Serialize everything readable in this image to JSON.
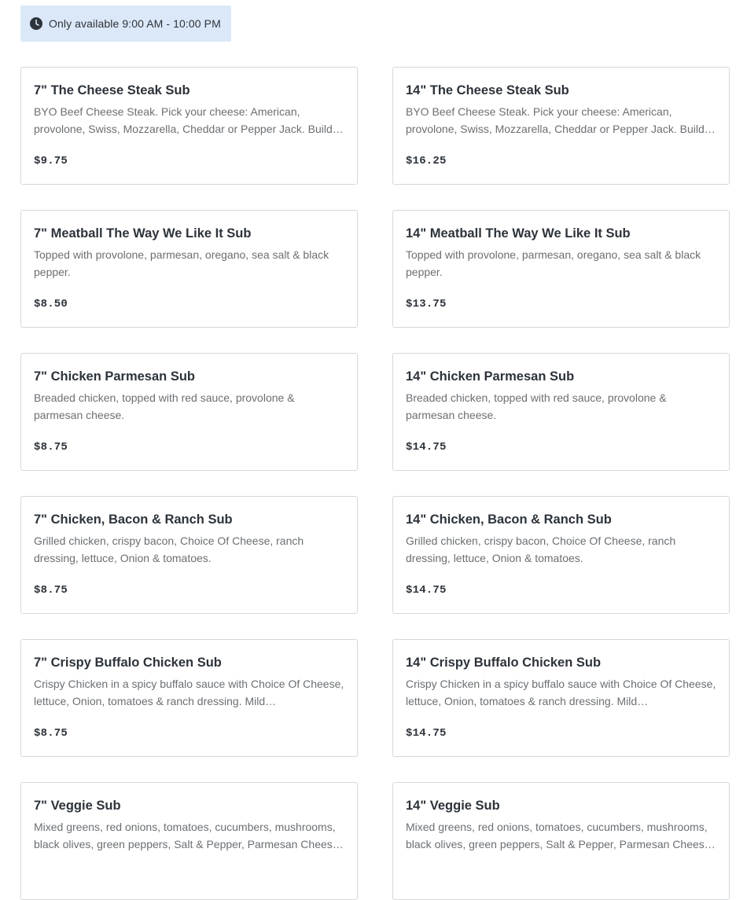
{
  "availability": {
    "icon": "clock-icon",
    "text": "Only available 9:00 AM - 10:00 PM"
  },
  "menu_items": [
    {
      "title": "7\" The Cheese Steak Sub",
      "description": "BYO Beef Cheese Steak. Pick your cheese: American, provolone, Swiss, Mozzarella, Cheddar or Pepper Jack. Build …",
      "price": "$9.75"
    },
    {
      "title": "14\" The Cheese Steak Sub",
      "description": "BYO Beef Cheese Steak. Pick your cheese: American, provolone, Swiss, Mozzarella, Cheddar or Pepper Jack. Build …",
      "price": "$16.25"
    },
    {
      "title": "7\" Meatball The Way We Like It Sub",
      "description": "Topped with provolone, parmesan, oregano, sea salt & black pepper.",
      "price": "$8.50"
    },
    {
      "title": "14\" Meatball The Way We Like It Sub",
      "description": "Topped with provolone, parmesan, oregano, sea salt & black pepper.",
      "price": "$13.75"
    },
    {
      "title": "7\" Chicken Parmesan Sub",
      "description": "Breaded chicken, topped with red sauce, provolone & parmesan cheese.",
      "price": "$8.75"
    },
    {
      "title": "14\" Chicken Parmesan Sub",
      "description": "Breaded chicken, topped with red sauce, provolone & parmesan cheese.",
      "price": "$14.75"
    },
    {
      "title": "7\" Chicken, Bacon & Ranch Sub",
      "description": "Grilled chicken, crispy bacon, Choice Of Cheese, ranch dressing, lettuce, Onion & tomatoes.",
      "price": "$8.75"
    },
    {
      "title": "14\" Chicken, Bacon & Ranch Sub",
      "description": "Grilled chicken, crispy bacon, Choice Of Cheese, ranch dressing, lettuce, Onion & tomatoes.",
      "price": "$14.75"
    },
    {
      "title": "7\" Crispy Buffalo Chicken Sub",
      "description": "Crispy Chicken in a spicy buffalo sauce with Choice Of Cheese, lettuce, Onion, tomatoes & ranch dressing. Mild…",
      "price": "$8.75"
    },
    {
      "title": "14\" Crispy Buffalo Chicken Sub",
      "description": "Crispy Chicken in a spicy buffalo sauce with Choice Of Cheese, lettuce, Onion, tomatoes & ranch dressing. Mild…",
      "price": "$14.75"
    },
    {
      "title": "7\" Veggie Sub",
      "description": "Mixed greens, red onions, tomatoes, cucumbers, mushrooms, black olives, green peppers, Salt & Pepper, Parmesan Chees…",
      "price": ""
    },
    {
      "title": "14\" Veggie Sub",
      "description": "Mixed greens, red onions, tomatoes, cucumbers, mushrooms, black olives, green peppers, Salt & Pepper, Parmesan Chees…",
      "price": ""
    }
  ],
  "colors": {
    "availability_bg": "#dbe8f7",
    "card_border": "#d5d8db",
    "text_primary": "#2d333a",
    "text_secondary": "#6b6f73"
  }
}
